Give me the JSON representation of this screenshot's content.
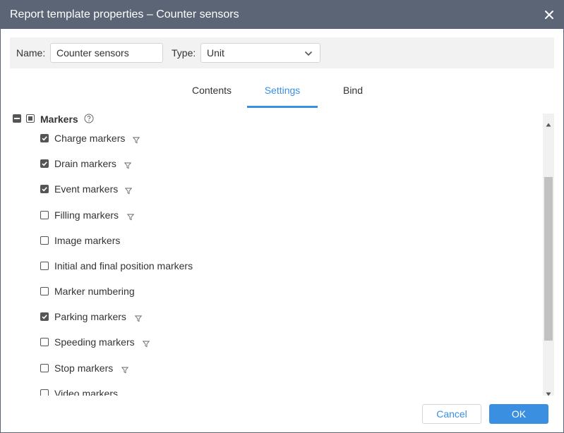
{
  "window": {
    "title": "Report template properties – Counter sensors"
  },
  "form": {
    "name_label": "Name:",
    "name_value": "Counter sensors",
    "type_label": "Type:",
    "type_value": "Unit"
  },
  "tabs": [
    {
      "label": "Contents",
      "active": false
    },
    {
      "label": "Settings",
      "active": true
    },
    {
      "label": "Bind",
      "active": false
    }
  ],
  "tree": {
    "group": {
      "label": "Markers"
    },
    "items": [
      {
        "label": "Charge markers",
        "checked": true,
        "filter": true
      },
      {
        "label": "Drain markers",
        "checked": true,
        "filter": true
      },
      {
        "label": "Event markers",
        "checked": true,
        "filter": true
      },
      {
        "label": "Filling markers",
        "checked": false,
        "filter": true
      },
      {
        "label": "Image markers",
        "checked": false,
        "filter": false
      },
      {
        "label": "Initial and final position markers",
        "checked": false,
        "filter": false
      },
      {
        "label": "Marker numbering",
        "checked": false,
        "filter": false
      },
      {
        "label": "Parking markers",
        "checked": true,
        "filter": true
      },
      {
        "label": "Speeding markers",
        "checked": false,
        "filter": true
      },
      {
        "label": "Stop markers",
        "checked": false,
        "filter": true
      },
      {
        "label": "Video markers",
        "checked": false,
        "filter": false
      }
    ]
  },
  "buttons": {
    "cancel_label": "Cancel",
    "ok_label": "OK"
  },
  "icons": {
    "close": "close-icon",
    "chevron": "chevron-down-icon",
    "help": "help-icon",
    "filter": "filter-icon"
  },
  "colors": {
    "titlebar": "#5b6575",
    "accent": "#3b8fe0"
  }
}
